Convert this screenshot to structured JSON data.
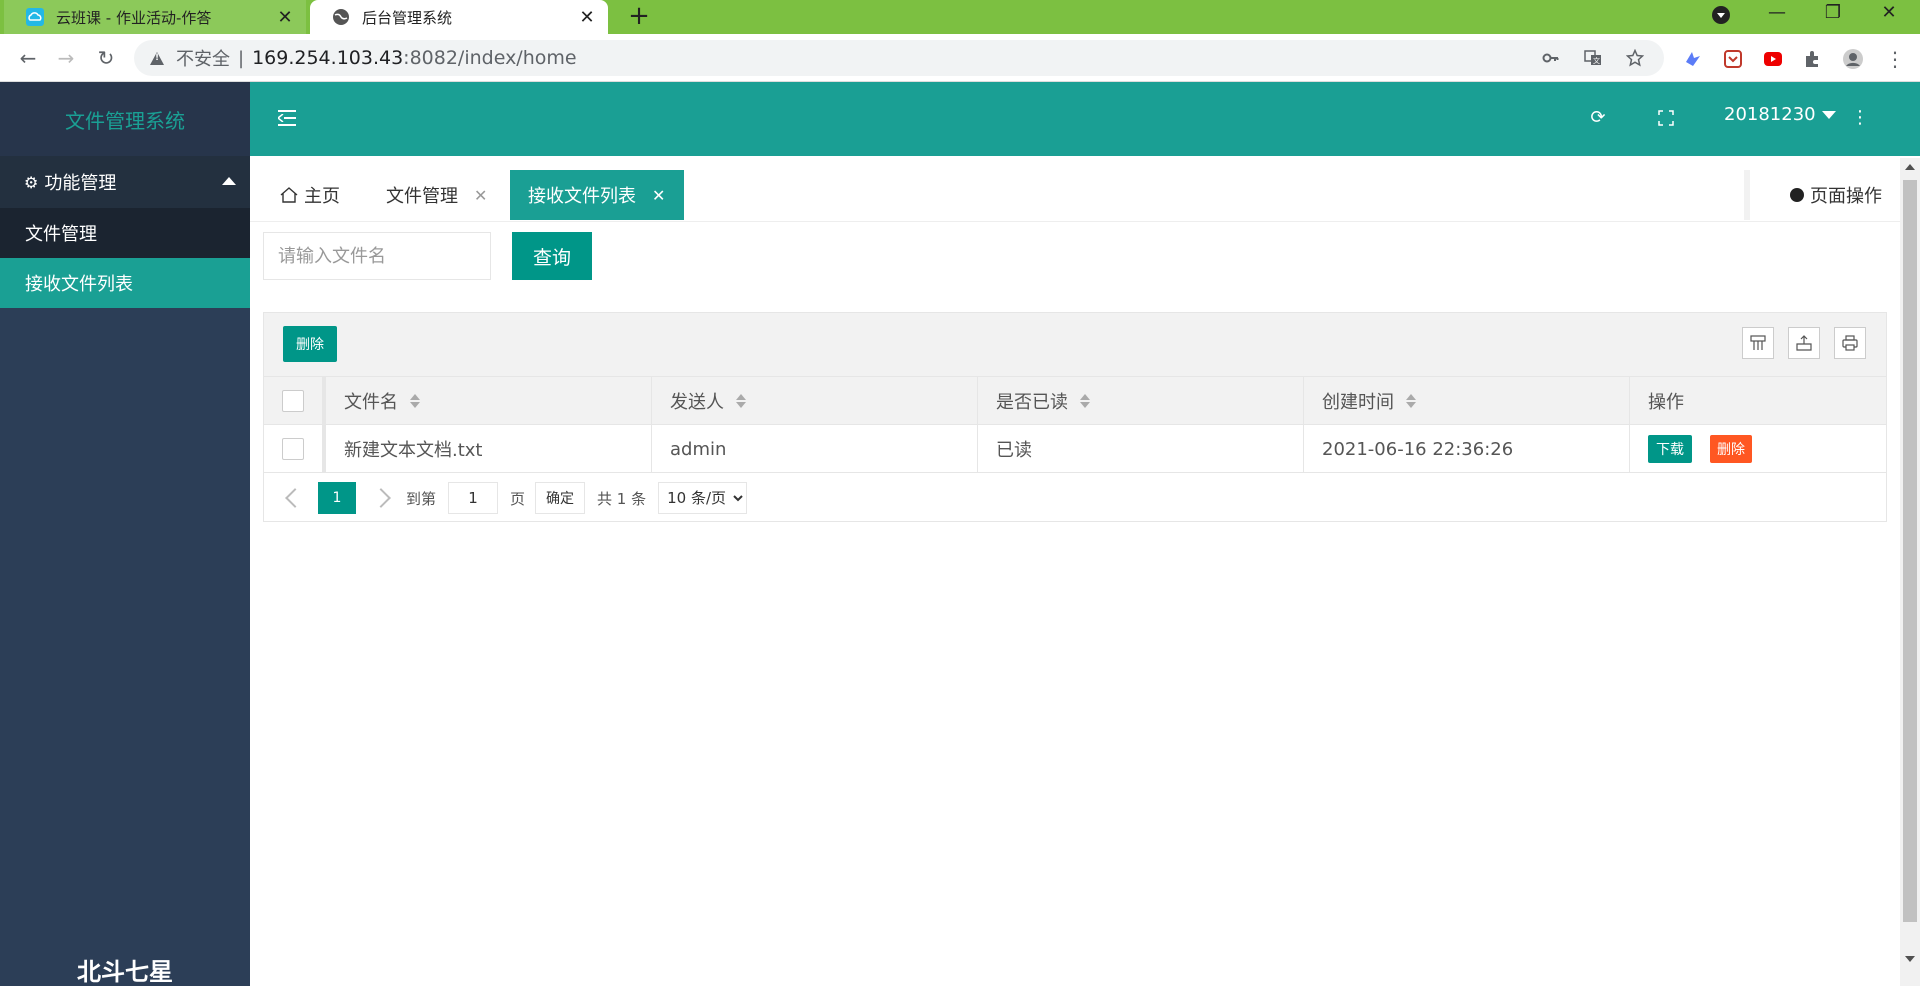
{
  "browser": {
    "tabs": [
      {
        "title": "云班课 - 作业活动-作答",
        "icon": "cloud-class-favicon"
      },
      {
        "title": "后台管理系统",
        "icon": "globe-icon"
      }
    ],
    "address": {
      "security_label": "不安全",
      "url_host": "169.254.103.43",
      "url_rest": ":8082/index/home"
    }
  },
  "app": {
    "logo": "文件管理系统",
    "menu_group": "功能管理",
    "menu_items": [
      "文件管理",
      "接收文件列表"
    ],
    "footer": "北斗七星",
    "username": "20181230"
  },
  "page_tabs": [
    {
      "label": "主页"
    },
    {
      "label": "文件管理"
    },
    {
      "label": "接收文件列表"
    }
  ],
  "page_ops": "页面操作",
  "search": {
    "placeholder": "请输入文件名",
    "button": "查询"
  },
  "toolbar": {
    "delete": "删除"
  },
  "table": {
    "columns": [
      "文件名",
      "发送人",
      "是否已读",
      "创建时间",
      "操作"
    ],
    "rows": [
      {
        "name": "新建文本文档.txt",
        "sender": "admin",
        "read": "已读",
        "created": "2021-06-16 22:36:26"
      }
    ],
    "actions": {
      "download": "下载",
      "delete": "删除"
    }
  },
  "pager": {
    "current": "1",
    "goto_label": "到第",
    "goto_value": "1",
    "page_suffix": "页",
    "confirm": "确定",
    "total": "共 1 条",
    "page_size": "10 条/页"
  },
  "colors": {
    "accent": "#1a9f94",
    "sidebar": "#2c3e57",
    "danger": "#ff5722",
    "browser_frame": "#7cc041"
  }
}
